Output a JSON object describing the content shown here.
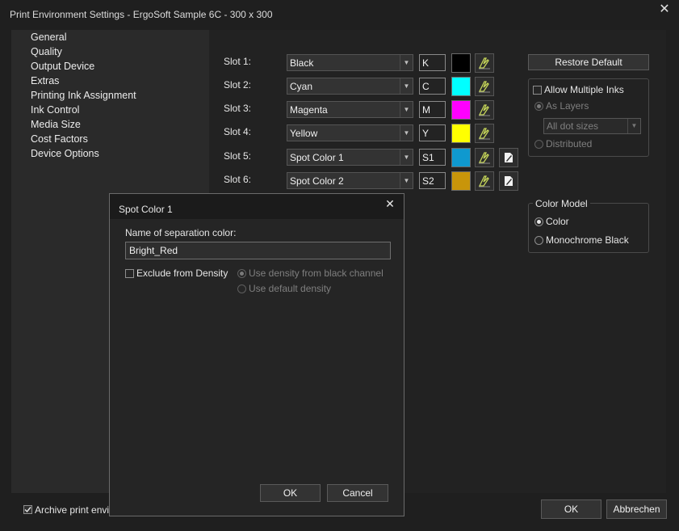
{
  "window": {
    "title": "Print Environment Settings - ErgoSoft Sample 6C - 300 x 300",
    "close": "✕"
  },
  "sidebar": {
    "items": [
      {
        "label": "General"
      },
      {
        "label": "Quality"
      },
      {
        "label": "Output Device"
      },
      {
        "label": "Extras"
      },
      {
        "label": "Printing Ink Assignment"
      },
      {
        "label": "Ink Control"
      },
      {
        "label": "Media Size"
      },
      {
        "label": "Cost Factors"
      },
      {
        "label": "Device Options"
      }
    ]
  },
  "slots": [
    {
      "label": "Slot 1:",
      "ink": "Black",
      "abbr": "K",
      "color": "#000000",
      "edit_icon": false
    },
    {
      "label": "Slot 2:",
      "ink": "Cyan",
      "abbr": "C",
      "color": "#00ffff",
      "edit_icon": false
    },
    {
      "label": "Slot 3:",
      "ink": "Magenta",
      "abbr": "M",
      "color": "#ff00ff",
      "edit_icon": false
    },
    {
      "label": "Slot 4:",
      "ink": "Yellow",
      "abbr": "Y",
      "color": "#ffff00",
      "edit_icon": false
    },
    {
      "label": "Slot 5:",
      "ink": "Spot Color 1",
      "abbr": "S1",
      "color": "#0f99cf",
      "edit_icon": true
    },
    {
      "label": "Slot 6:",
      "ink": "Spot Color 2",
      "abbr": "S2",
      "color": "#c8950a",
      "edit_icon": true
    }
  ],
  "right_panel": {
    "restore_default": "Restore Default",
    "allow_multiple_inks": {
      "label": "Allow Multiple Inks",
      "checked": false
    },
    "as_layers": {
      "label": "As Layers",
      "selected": true,
      "enabled": false
    },
    "dot_sizes": {
      "value": "All dot sizes",
      "enabled": false
    },
    "distributed": {
      "label": "Distributed",
      "selected": false,
      "enabled": false
    },
    "color_model": {
      "title": "Color Model",
      "options": [
        {
          "label": "Color",
          "selected": true
        },
        {
          "label": "Monochrome Black",
          "selected": false
        }
      ]
    }
  },
  "footer": {
    "archive_label": "Archive print enviro",
    "archive_checked": true,
    "ok": "OK",
    "cancel": "Abbrechen"
  },
  "dialog": {
    "title": "Spot Color 1",
    "close": "✕",
    "name_label": "Name of separation color:",
    "name_value": "Bright_Red",
    "exclude_density": {
      "label": "Exclude from Density",
      "checked": false
    },
    "use_black_density": {
      "label": "Use density from black channel",
      "selected": true,
      "enabled": false
    },
    "use_default_density": {
      "label": "Use default density",
      "selected": false,
      "enabled": false
    },
    "ok": "OK",
    "cancel": "Cancel"
  },
  "colors": {
    "background": "#1f1f1f",
    "panel": "#2a2a2a",
    "main": "#222222",
    "icon_accent": "#c8d85a"
  },
  "icons": {
    "auto_ink": "ink-pen-icon",
    "edit_spot": "edit-page-icon",
    "dropdown": "chevron-down-icon"
  }
}
